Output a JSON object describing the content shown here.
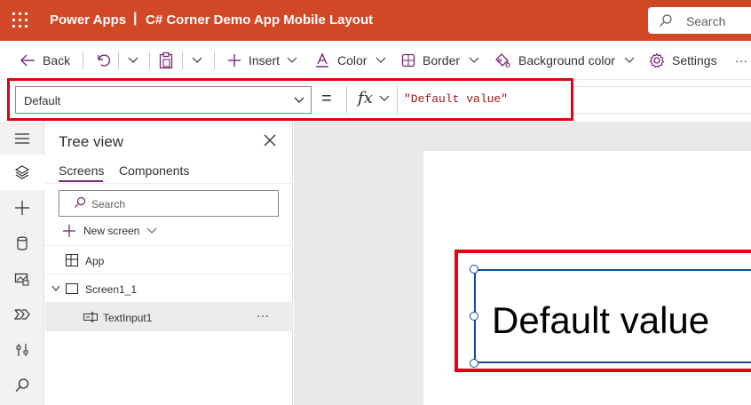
{
  "header": {
    "app_name": "Power Apps",
    "separator": "|",
    "title": "C# Corner Demo App Mobile Layout",
    "search_label": "Search"
  },
  "commands": {
    "back": "Back",
    "insert": "Insert",
    "color": "Color",
    "border": "Border",
    "background_color": "Background color",
    "settings": "Settings",
    "more": "···"
  },
  "formula_bar": {
    "property": "Default",
    "equals": "=",
    "fx": "fx",
    "formula": "\"Default value\""
  },
  "tree_view": {
    "title": "Tree view",
    "tabs": [
      "Screens",
      "Components"
    ],
    "search_placeholder": "Search",
    "new_screen": "New screen",
    "items": [
      {
        "label": "App"
      },
      {
        "label": "Screen1_1"
      },
      {
        "label": "TextInput1"
      }
    ],
    "more": "···"
  },
  "canvas": {
    "text_input_value": "Default value"
  },
  "colors": {
    "header_bg": "#d24726",
    "highlight": "#e3000f",
    "selection_border": "#0f4c9c"
  }
}
